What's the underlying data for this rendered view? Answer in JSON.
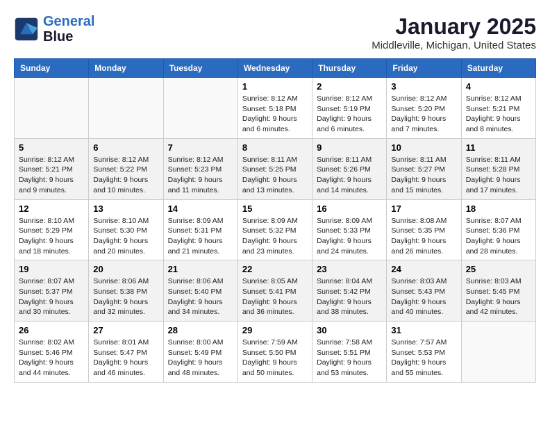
{
  "header": {
    "logo_line1": "General",
    "logo_line2": "Blue",
    "title": "January 2025",
    "subtitle": "Middleville, Michigan, United States"
  },
  "weekdays": [
    "Sunday",
    "Monday",
    "Tuesday",
    "Wednesday",
    "Thursday",
    "Friday",
    "Saturday"
  ],
  "weeks": [
    [
      {
        "day": "",
        "sunrise": "",
        "sunset": "",
        "daylight": "",
        "empty": true
      },
      {
        "day": "",
        "sunrise": "",
        "sunset": "",
        "daylight": "",
        "empty": true
      },
      {
        "day": "",
        "sunrise": "",
        "sunset": "",
        "daylight": "",
        "empty": true
      },
      {
        "day": "1",
        "sunrise": "Sunrise: 8:12 AM",
        "sunset": "Sunset: 5:18 PM",
        "daylight": "Daylight: 9 hours and 6 minutes.",
        "empty": false
      },
      {
        "day": "2",
        "sunrise": "Sunrise: 8:12 AM",
        "sunset": "Sunset: 5:19 PM",
        "daylight": "Daylight: 9 hours and 6 minutes.",
        "empty": false
      },
      {
        "day": "3",
        "sunrise": "Sunrise: 8:12 AM",
        "sunset": "Sunset: 5:20 PM",
        "daylight": "Daylight: 9 hours and 7 minutes.",
        "empty": false
      },
      {
        "day": "4",
        "sunrise": "Sunrise: 8:12 AM",
        "sunset": "Sunset: 5:21 PM",
        "daylight": "Daylight: 9 hours and 8 minutes.",
        "empty": false
      }
    ],
    [
      {
        "day": "5",
        "sunrise": "Sunrise: 8:12 AM",
        "sunset": "Sunset: 5:21 PM",
        "daylight": "Daylight: 9 hours and 9 minutes.",
        "empty": false
      },
      {
        "day": "6",
        "sunrise": "Sunrise: 8:12 AM",
        "sunset": "Sunset: 5:22 PM",
        "daylight": "Daylight: 9 hours and 10 minutes.",
        "empty": false
      },
      {
        "day": "7",
        "sunrise": "Sunrise: 8:12 AM",
        "sunset": "Sunset: 5:23 PM",
        "daylight": "Daylight: 9 hours and 11 minutes.",
        "empty": false
      },
      {
        "day": "8",
        "sunrise": "Sunrise: 8:11 AM",
        "sunset": "Sunset: 5:25 PM",
        "daylight": "Daylight: 9 hours and 13 minutes.",
        "empty": false
      },
      {
        "day": "9",
        "sunrise": "Sunrise: 8:11 AM",
        "sunset": "Sunset: 5:26 PM",
        "daylight": "Daylight: 9 hours and 14 minutes.",
        "empty": false
      },
      {
        "day": "10",
        "sunrise": "Sunrise: 8:11 AM",
        "sunset": "Sunset: 5:27 PM",
        "daylight": "Daylight: 9 hours and 15 minutes.",
        "empty": false
      },
      {
        "day": "11",
        "sunrise": "Sunrise: 8:11 AM",
        "sunset": "Sunset: 5:28 PM",
        "daylight": "Daylight: 9 hours and 17 minutes.",
        "empty": false
      }
    ],
    [
      {
        "day": "12",
        "sunrise": "Sunrise: 8:10 AM",
        "sunset": "Sunset: 5:29 PM",
        "daylight": "Daylight: 9 hours and 18 minutes.",
        "empty": false
      },
      {
        "day": "13",
        "sunrise": "Sunrise: 8:10 AM",
        "sunset": "Sunset: 5:30 PM",
        "daylight": "Daylight: 9 hours and 20 minutes.",
        "empty": false
      },
      {
        "day": "14",
        "sunrise": "Sunrise: 8:09 AM",
        "sunset": "Sunset: 5:31 PM",
        "daylight": "Daylight: 9 hours and 21 minutes.",
        "empty": false
      },
      {
        "day": "15",
        "sunrise": "Sunrise: 8:09 AM",
        "sunset": "Sunset: 5:32 PM",
        "daylight": "Daylight: 9 hours and 23 minutes.",
        "empty": false
      },
      {
        "day": "16",
        "sunrise": "Sunrise: 8:09 AM",
        "sunset": "Sunset: 5:33 PM",
        "daylight": "Daylight: 9 hours and 24 minutes.",
        "empty": false
      },
      {
        "day": "17",
        "sunrise": "Sunrise: 8:08 AM",
        "sunset": "Sunset: 5:35 PM",
        "daylight": "Daylight: 9 hours and 26 minutes.",
        "empty": false
      },
      {
        "day": "18",
        "sunrise": "Sunrise: 8:07 AM",
        "sunset": "Sunset: 5:36 PM",
        "daylight": "Daylight: 9 hours and 28 minutes.",
        "empty": false
      }
    ],
    [
      {
        "day": "19",
        "sunrise": "Sunrise: 8:07 AM",
        "sunset": "Sunset: 5:37 PM",
        "daylight": "Daylight: 9 hours and 30 minutes.",
        "empty": false
      },
      {
        "day": "20",
        "sunrise": "Sunrise: 8:06 AM",
        "sunset": "Sunset: 5:38 PM",
        "daylight": "Daylight: 9 hours and 32 minutes.",
        "empty": false
      },
      {
        "day": "21",
        "sunrise": "Sunrise: 8:06 AM",
        "sunset": "Sunset: 5:40 PM",
        "daylight": "Daylight: 9 hours and 34 minutes.",
        "empty": false
      },
      {
        "day": "22",
        "sunrise": "Sunrise: 8:05 AM",
        "sunset": "Sunset: 5:41 PM",
        "daylight": "Daylight: 9 hours and 36 minutes.",
        "empty": false
      },
      {
        "day": "23",
        "sunrise": "Sunrise: 8:04 AM",
        "sunset": "Sunset: 5:42 PM",
        "daylight": "Daylight: 9 hours and 38 minutes.",
        "empty": false
      },
      {
        "day": "24",
        "sunrise": "Sunrise: 8:03 AM",
        "sunset": "Sunset: 5:43 PM",
        "daylight": "Daylight: 9 hours and 40 minutes.",
        "empty": false
      },
      {
        "day": "25",
        "sunrise": "Sunrise: 8:03 AM",
        "sunset": "Sunset: 5:45 PM",
        "daylight": "Daylight: 9 hours and 42 minutes.",
        "empty": false
      }
    ],
    [
      {
        "day": "26",
        "sunrise": "Sunrise: 8:02 AM",
        "sunset": "Sunset: 5:46 PM",
        "daylight": "Daylight: 9 hours and 44 minutes.",
        "empty": false
      },
      {
        "day": "27",
        "sunrise": "Sunrise: 8:01 AM",
        "sunset": "Sunset: 5:47 PM",
        "daylight": "Daylight: 9 hours and 46 minutes.",
        "empty": false
      },
      {
        "day": "28",
        "sunrise": "Sunrise: 8:00 AM",
        "sunset": "Sunset: 5:49 PM",
        "daylight": "Daylight: 9 hours and 48 minutes.",
        "empty": false
      },
      {
        "day": "29",
        "sunrise": "Sunrise: 7:59 AM",
        "sunset": "Sunset: 5:50 PM",
        "daylight": "Daylight: 9 hours and 50 minutes.",
        "empty": false
      },
      {
        "day": "30",
        "sunrise": "Sunrise: 7:58 AM",
        "sunset": "Sunset: 5:51 PM",
        "daylight": "Daylight: 9 hours and 53 minutes.",
        "empty": false
      },
      {
        "day": "31",
        "sunrise": "Sunrise: 7:57 AM",
        "sunset": "Sunset: 5:53 PM",
        "daylight": "Daylight: 9 hours and 55 minutes.",
        "empty": false
      },
      {
        "day": "",
        "sunrise": "",
        "sunset": "",
        "daylight": "",
        "empty": true
      }
    ]
  ]
}
